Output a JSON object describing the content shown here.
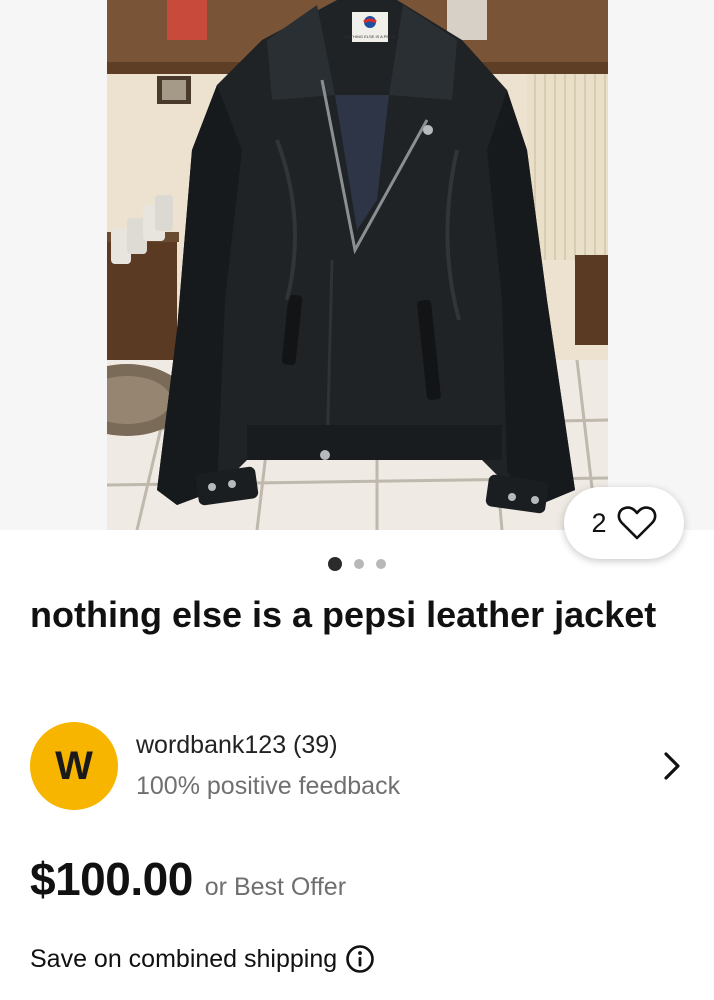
{
  "listing": {
    "watch_count": "2",
    "photo_label": "NOTHING ELSE IS A PEPSI",
    "carousel": {
      "total": 3,
      "active": 1
    },
    "title": "nothing else is a pepsi leather jacket"
  },
  "seller": {
    "avatar_letter": "W",
    "name": "wordbank123 (39)",
    "feedback": "100% positive feedback"
  },
  "price": {
    "amount": "$100.00",
    "offer_text": "or Best Offer"
  },
  "shipping": {
    "text": "Save on combined shipping"
  },
  "icons": {
    "watch": "heart-icon",
    "seller_link": "chevron-right-icon",
    "shipping_info": "info-icon"
  },
  "colors": {
    "avatar_bg": "#f7b500",
    "text_primary": "#111111",
    "text_secondary": "#707070"
  }
}
